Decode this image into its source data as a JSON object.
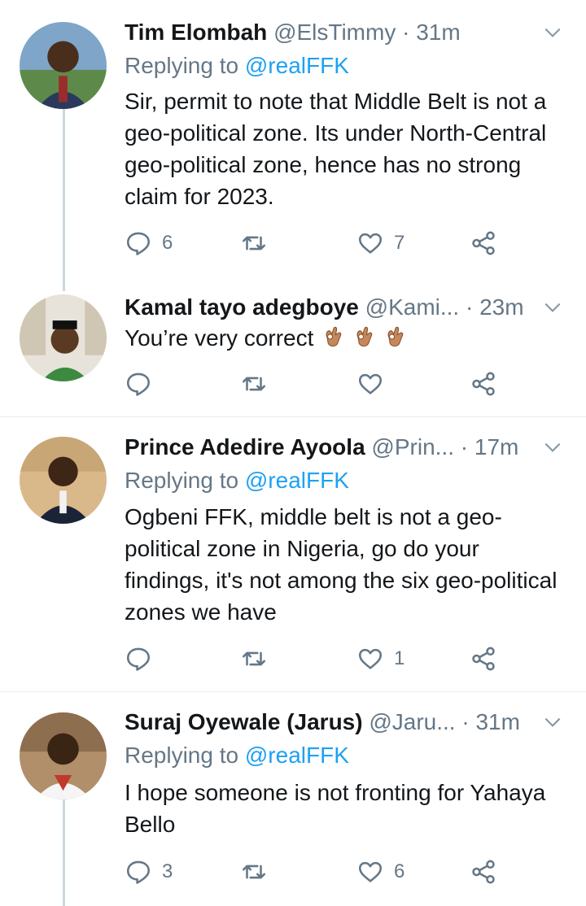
{
  "tweets": [
    {
      "name": "Tim Elombah",
      "handle": "@ElsTimmy",
      "dot": "·",
      "time": "31m",
      "replying_label": "Replying to ",
      "replying_to": "@realFFK",
      "text": "Sir, permit to note that Middle Belt is not a geo-political zone. Its under North-Central geo-political zone, hence has no strong claim for 2023.",
      "replies": "6",
      "retweets": "",
      "likes": "7"
    },
    {
      "name": "Kamal tayo adegboye",
      "handle": "@Kami...",
      "dot": "·",
      "time": "23m",
      "text": "You’re very correct",
      "emoji": [
        "ok-hand-emoji",
        "ok-hand-emoji",
        "ok-hand-emoji"
      ],
      "replies": "",
      "retweets": "",
      "likes": ""
    },
    {
      "name": "Prince Adedire Ayoola",
      "handle": "@Prin...",
      "dot": "·",
      "time": "17m",
      "replying_label": "Replying to ",
      "replying_to": "@realFFK",
      "text": "Ogbeni FFK, middle belt is not a geo-political zone in Nigeria, go do your findings, it's not among the six geo-political zones we have",
      "replies": "",
      "retweets": "",
      "likes": "1"
    },
    {
      "name": "Suraj Oyewale (Jarus)",
      "handle": "@Jaru...",
      "dot": "·",
      "time": "31m",
      "replying_label": "Replying to ",
      "replying_to": "@realFFK",
      "text": "I hope someone is not fronting for Yahaya Bello",
      "replies": "3",
      "retweets": "",
      "likes": "6"
    }
  ],
  "colors": {
    "text": "#14171a",
    "muted": "#657786",
    "link": "#1da1f2",
    "divider": "#e6ecf0",
    "thread": "#ccd6dd"
  },
  "icons": [
    "reply-icon",
    "retweet-icon",
    "like-icon",
    "share-icon",
    "chevron-down-icon"
  ]
}
